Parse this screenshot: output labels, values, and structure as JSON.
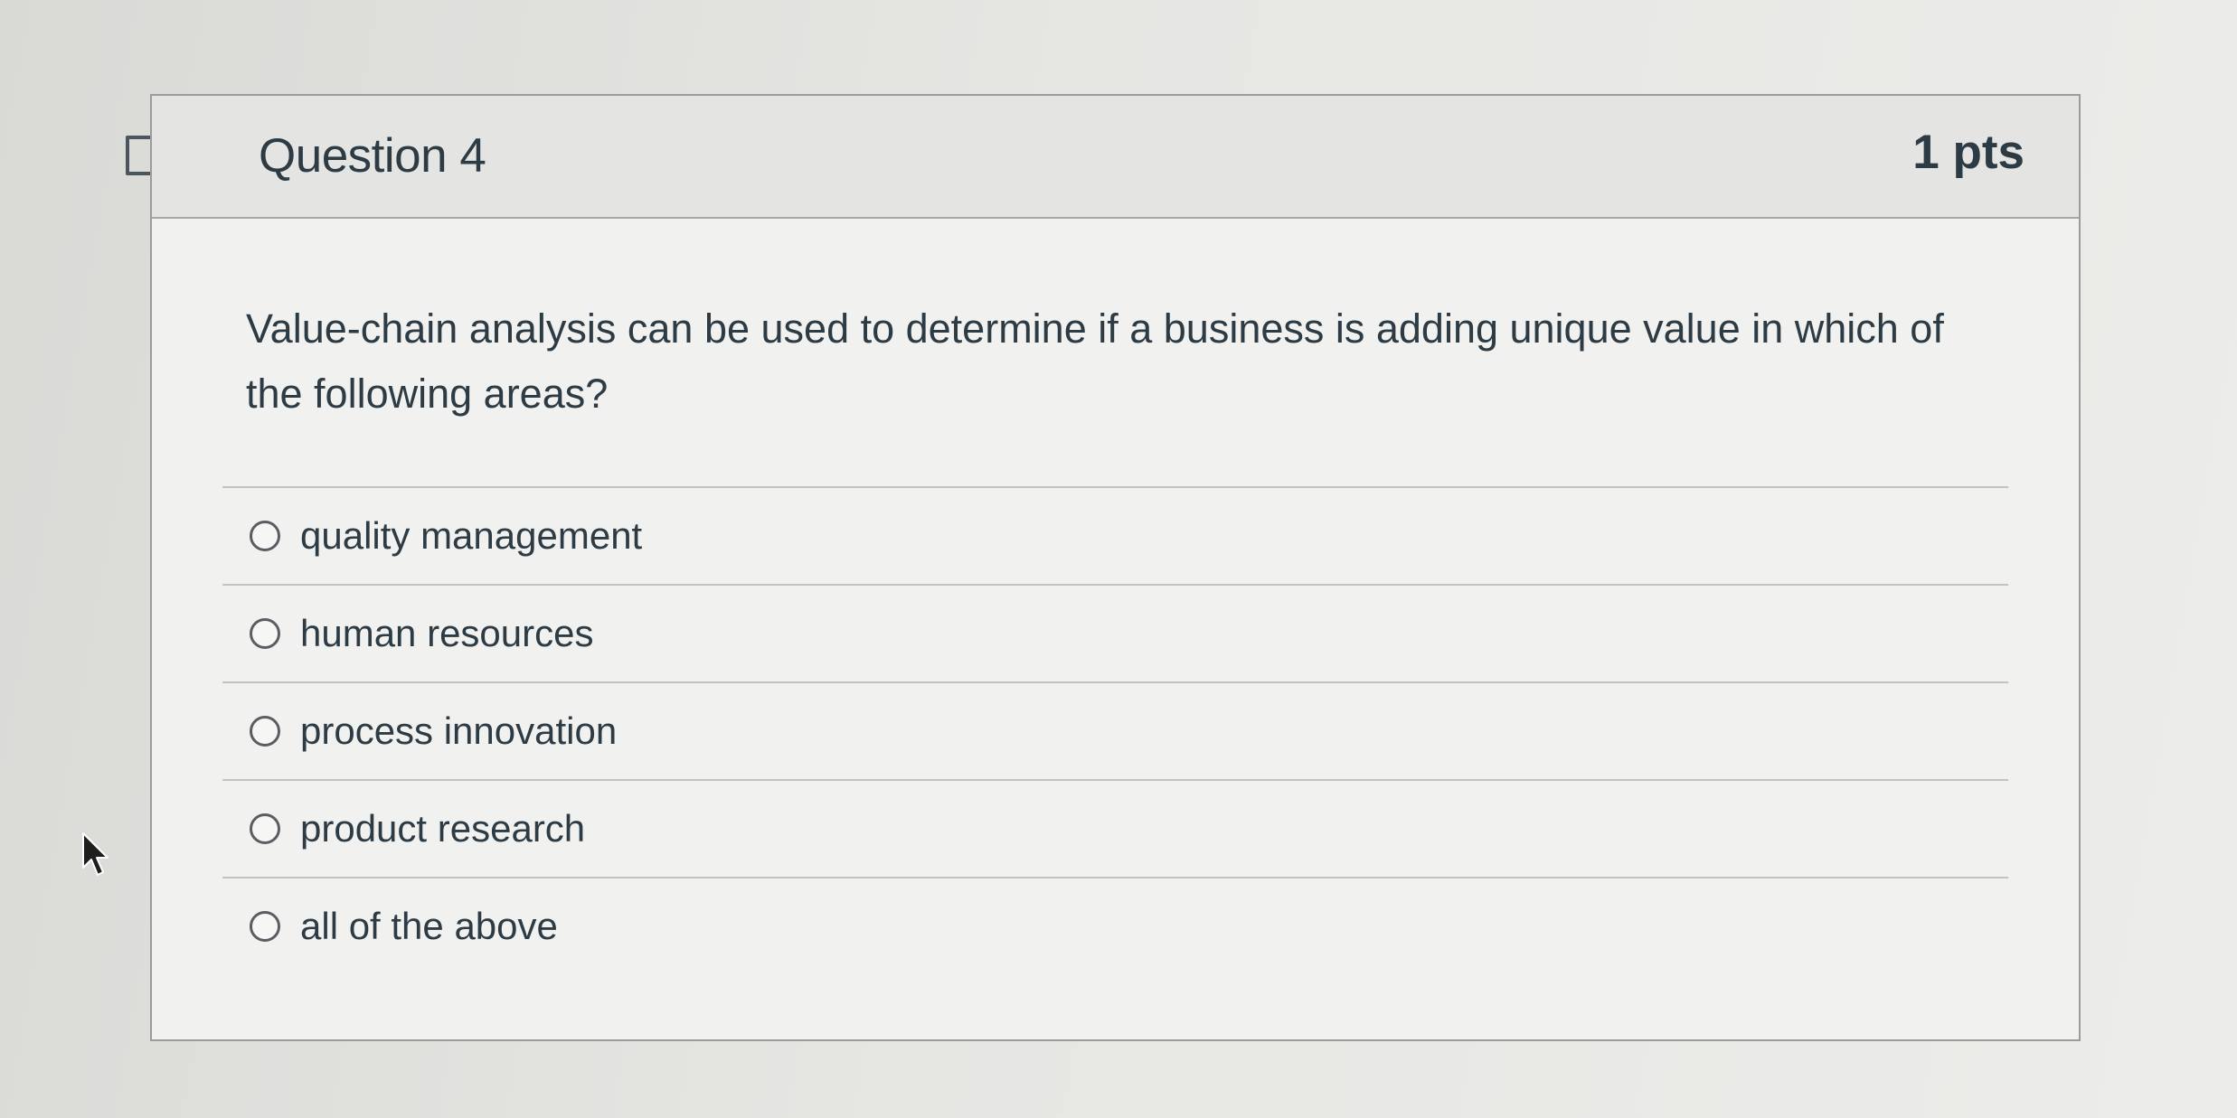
{
  "question": {
    "title": "Question 4",
    "points": "1 pts",
    "text": "Value-chain analysis can be used to determine if a business is adding unique value in which of the following areas?",
    "answers": [
      {
        "label": "quality management",
        "selected": false
      },
      {
        "label": "human resources",
        "selected": false
      },
      {
        "label": "process innovation",
        "selected": false
      },
      {
        "label": "product research",
        "selected": false
      },
      {
        "label": "all of the above",
        "selected": false
      }
    ]
  },
  "icons": {
    "flag": "flag-question-icon",
    "cursor": "mouse-pointer-icon"
  },
  "colors": {
    "text": "#2d3b45",
    "header_bg": "#e4e4e2",
    "card_bg": "#f1f1ef",
    "border": "#9c9c9a"
  }
}
